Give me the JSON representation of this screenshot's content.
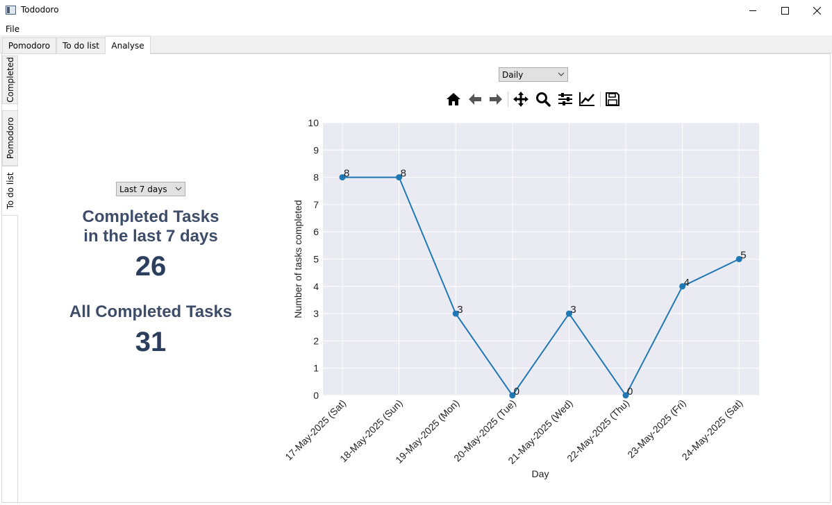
{
  "window": {
    "title": "Tododoro",
    "icons": {
      "app": "app-icon",
      "minimize": "minimize-icon",
      "maximize": "maximize-icon",
      "close": "close-icon"
    }
  },
  "menu": {
    "file": "File"
  },
  "tabs": [
    {
      "label": "Pomodoro",
      "active": false
    },
    {
      "label": "To do list",
      "active": false
    },
    {
      "label": "Analyse",
      "active": true
    }
  ],
  "side_tabs": [
    {
      "label": "Completed",
      "active": false
    },
    {
      "label": "Pomodoro",
      "active": false
    },
    {
      "label": "To do list",
      "active": true
    }
  ],
  "left_panel": {
    "range_select": "Last 7 days",
    "completed_heading_line1": "Completed Tasks",
    "completed_heading_line2": "in the last 7 days",
    "completed_count": "26",
    "all_heading": "All Completed Tasks",
    "all_count": "31"
  },
  "right_panel": {
    "period_select": "Daily",
    "toolbar_icons": [
      "home-icon",
      "back-arrow-icon",
      "forward-arrow-icon",
      "pan-icon",
      "zoom-icon",
      "configure-subplots-icon",
      "edit-axis-icon",
      "save-icon"
    ]
  },
  "colors": {
    "plot_bg": "#eaeaf2",
    "line": "#1f77b4",
    "stat_text": "#3d4c68"
  },
  "chart_data": {
    "type": "line",
    "title": "",
    "xlabel": "Day",
    "ylabel": "Number of tasks completed",
    "categories": [
      "17-May-2025 (Sat)",
      "18-May-2025 (Sun)",
      "19-May-2025 (Mon)",
      "20-May-2025 (Tue)",
      "21-May-2025 (Wed)",
      "22-May-2025 (Thu)",
      "23-May-2025 (Fri)",
      "24-May-2025 (Sat)"
    ],
    "values": [
      8,
      8,
      3,
      0,
      3,
      0,
      4,
      5
    ],
    "ylim": [
      0,
      10
    ],
    "yticks": [
      0,
      1,
      2,
      3,
      4,
      5,
      6,
      7,
      8,
      9,
      10
    ],
    "grid": true,
    "data_labels": true
  }
}
